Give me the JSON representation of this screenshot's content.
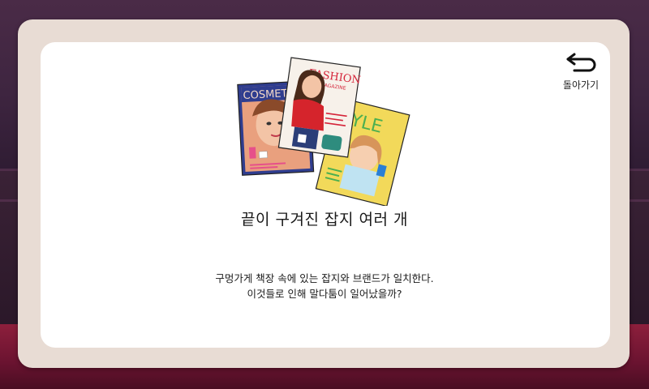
{
  "back_button": {
    "label": "돌아가기",
    "icon": "back-arrow-icon"
  },
  "item": {
    "title": "끝이 구겨진 잡지 여러 개",
    "description_lines": [
      "구멍가게 책장 속에 있는 잡지와 브랜드가 일치한다.",
      "이것들로 인해 말다툼이 일어났을까?"
    ],
    "image": {
      "name": "magazines-illustration",
      "magazines": [
        {
          "cover_text": "COSMET"
        },
        {
          "cover_text": "FASHION",
          "sub_text": "MAGAZINE"
        },
        {
          "cover_text": "TYLE"
        }
      ]
    }
  },
  "colors": {
    "panel_outer": "#e8dcd4",
    "panel_inner": "#ffffff",
    "background": "#3a2434",
    "floor": "#8d1f3c"
  }
}
